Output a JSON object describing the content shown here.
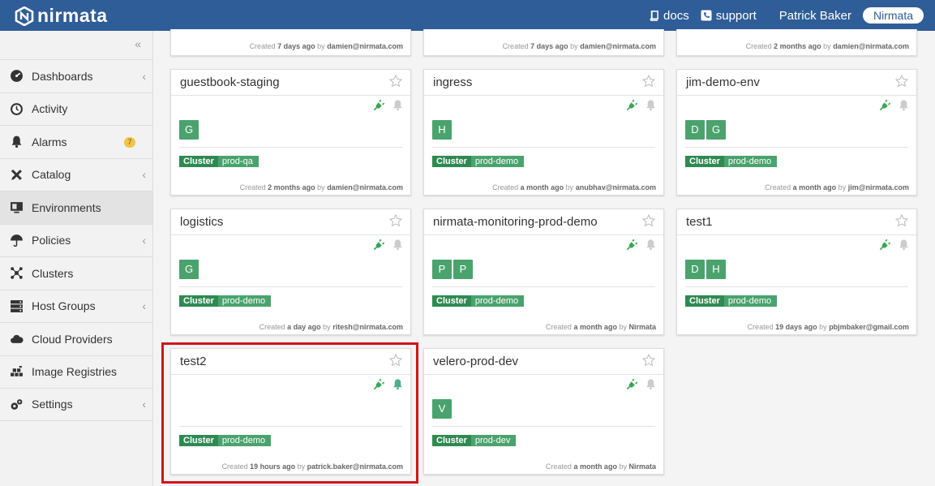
{
  "brand": {
    "name": "nirmata"
  },
  "topnav": {
    "docs": "docs",
    "support": "support",
    "user": "Patrick Baker",
    "org": "Nirmata"
  },
  "sidebar": {
    "items": [
      {
        "label": "Dashboards",
        "icon": "dashboard-icon",
        "chevron": true
      },
      {
        "label": "Activity",
        "icon": "clock-icon"
      },
      {
        "label": "Alarms",
        "icon": "bell-icon",
        "badge": "7"
      },
      {
        "label": "Catalog",
        "icon": "tools-icon",
        "chevron": true
      },
      {
        "label": "Environments",
        "icon": "monitor-icon",
        "active": true
      },
      {
        "label": "Policies",
        "icon": "umbrella-icon",
        "chevron": true
      },
      {
        "label": "Clusters",
        "icon": "cluster-icon"
      },
      {
        "label": "Host Groups",
        "icon": "server-icon",
        "chevron": true
      },
      {
        "label": "Cloud Providers",
        "icon": "cloud-icon"
      },
      {
        "label": "Image Registries",
        "icon": "registry-icon"
      },
      {
        "label": "Settings",
        "icon": "gears-icon",
        "chevron": true
      }
    ]
  },
  "top_cards": [
    {
      "created": "Created",
      "when": "7 days ago",
      "by": "by",
      "user": "damien@nirmata.com"
    },
    {
      "created": "Created",
      "when": "7 days ago",
      "by": "by",
      "user": "damien@nirmata.com"
    },
    {
      "created": "Created",
      "when": "2 months ago",
      "by": "by",
      "user": "damien@nirmata.com"
    }
  ],
  "cards": [
    {
      "title": "guestbook-staging",
      "hosts": [
        "G"
      ],
      "cluster_key": "Cluster",
      "cluster_value": "prod-qa",
      "created": "Created",
      "when": "2 months ago",
      "by": "by",
      "user": "damien@nirmata.com",
      "bell_active": false
    },
    {
      "title": "ingress",
      "hosts": [
        "H"
      ],
      "cluster_key": "Cluster",
      "cluster_value": "prod-demo",
      "created": "Created",
      "when": "a month ago",
      "by": "by",
      "user": "anubhav@nirmata.com",
      "bell_active": false
    },
    {
      "title": "jim-demo-env",
      "hosts": [
        "D",
        "G"
      ],
      "cluster_key": "Cluster",
      "cluster_value": "prod-demo",
      "created": "Created",
      "when": "a month ago",
      "by": "by",
      "user": "jim@nirmata.com",
      "bell_active": false
    },
    {
      "title": "logistics",
      "hosts": [
        "G"
      ],
      "cluster_key": "Cluster",
      "cluster_value": "prod-demo",
      "created": "Created",
      "when": "a day ago",
      "by": "by",
      "user": "ritesh@nirmata.com",
      "bell_active": false
    },
    {
      "title": "nirmata-monitoring-prod-demo",
      "hosts": [
        "P",
        "P"
      ],
      "cluster_key": "Cluster",
      "cluster_value": "prod-demo",
      "created": "Created",
      "when": "a month ago",
      "by": "by",
      "user": "Nirmata",
      "bell_active": false
    },
    {
      "title": "test1",
      "hosts": [
        "D",
        "H"
      ],
      "cluster_key": "Cluster",
      "cluster_value": "prod-demo",
      "created": "Created",
      "when": "19 days ago",
      "by": "by",
      "user": "pbjmbaker@gmail.com",
      "bell_active": false
    },
    {
      "title": "test2",
      "hosts": [],
      "cluster_key": "Cluster",
      "cluster_value": "prod-demo",
      "created": "Created",
      "when": "19 hours ago",
      "by": "by",
      "user": "patrick.baker@nirmata.com",
      "bell_active": true
    },
    {
      "title": "velero-prod-dev",
      "hosts": [
        "V"
      ],
      "cluster_key": "Cluster",
      "cluster_value": "prod-dev",
      "created": "Created",
      "when": "a month ago",
      "by": "by",
      "user": "Nirmata",
      "bell_active": false
    }
  ],
  "colors": {
    "topbar": "#2f5d97",
    "host": "#4aa36d",
    "cluster_key": "#2f8a52",
    "plug": "#3aa655",
    "bell_active": "#4aaf8f",
    "highlight": "#d0161b"
  }
}
